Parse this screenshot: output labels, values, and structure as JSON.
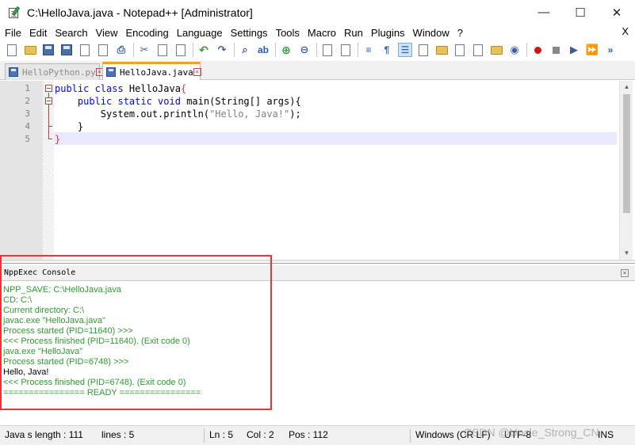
{
  "window": {
    "title": "C:\\HelloJava.java - Notepad++ [Administrator]",
    "minimize": "—",
    "maximize": "☐",
    "close": "✕"
  },
  "menu": {
    "items": [
      "File",
      "Edit",
      "Search",
      "View",
      "Encoding",
      "Language",
      "Settings",
      "Tools",
      "Macro",
      "Run",
      "Plugins",
      "Window",
      "?"
    ],
    "close_label": "X"
  },
  "tabs": [
    {
      "label": "HelloPython.py",
      "active": false
    },
    {
      "label": "HelloJava.java",
      "active": true
    }
  ],
  "editor": {
    "line_numbers": [
      "1",
      "2",
      "3",
      "4",
      "5"
    ],
    "current_line": 5
  },
  "code": {
    "l1_kw": "public class ",
    "l1_name": "HelloJava",
    "l1_brace": "{",
    "l2_indent": "    ",
    "l2_kw": "public static void ",
    "l2_rest": "main(String[] args){",
    "l3_indent": "        ",
    "l3_call": "System.out.println(",
    "l3_str": "\"Hello, Java!\"",
    "l3_end": ");",
    "l4": "    }",
    "l5": "}"
  },
  "console": {
    "title": "NppExec Console",
    "close": "✕",
    "lines": [
      {
        "text": "NPP_SAVE: C:\\HelloJava.java",
        "kind": "info"
      },
      {
        "text": "CD: C:\\",
        "kind": "info"
      },
      {
        "text": "Current directory: C:\\",
        "kind": "info"
      },
      {
        "text": "javac.exe \"HelloJava.java\"",
        "kind": "info"
      },
      {
        "text": "Process started (PID=11640) >>>",
        "kind": "info"
      },
      {
        "text": "<<< Process finished (PID=11640). (Exit code 0)",
        "kind": "info"
      },
      {
        "text": "java.exe \"HelloJava\"",
        "kind": "info"
      },
      {
        "text": "Process started (PID=6748) >>>",
        "kind": "info"
      },
      {
        "text": "Hello, Java!",
        "kind": "output"
      },
      {
        "text": "<<< Process finished (PID=6748). (Exit code 0)",
        "kind": "info"
      },
      {
        "text": "================ READY ================",
        "kind": "info"
      }
    ]
  },
  "status": {
    "filetype": "Java s",
    "length": "length : 111",
    "lines": "lines : 5",
    "ln": "Ln : 5",
    "col": "Col : 2",
    "pos": "Pos : 112",
    "eol": "Windows (CR LF)",
    "encoding": "UTF-8",
    "mode": "INS"
  },
  "watermark": "CSDN @Uncle_Strong_CN",
  "colors": {
    "keyword": "#0000ff",
    "string": "#808080",
    "console_text": "#2f9a2f",
    "highlight_box": "#e33333",
    "tab_accent": "#f0a030"
  }
}
